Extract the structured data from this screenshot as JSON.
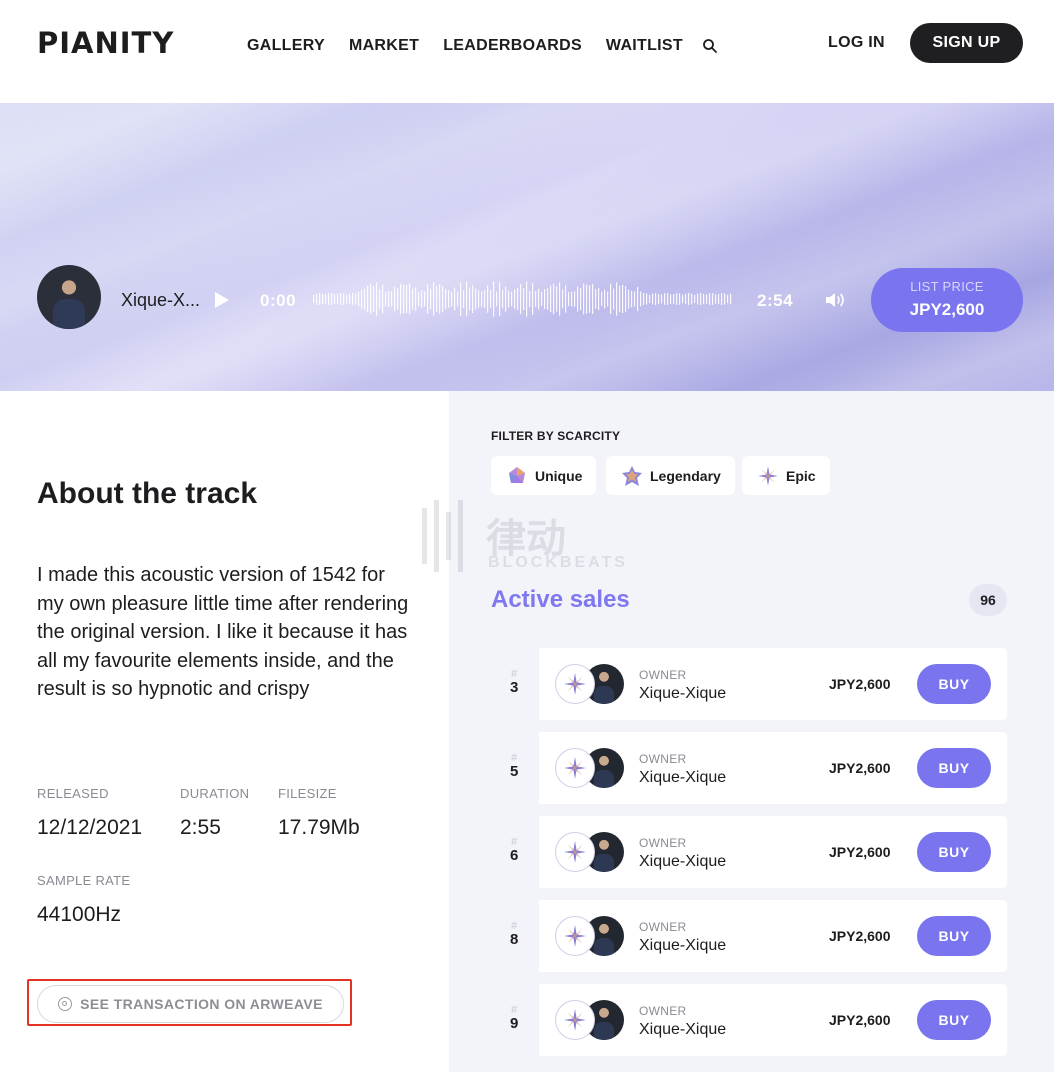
{
  "header": {
    "logo": "PIANITY",
    "nav": [
      "GALLERY",
      "MARKET",
      "LEADERBOARDS",
      "WAITLIST"
    ],
    "login_label": "LOG IN",
    "signup_label": "SIGN UP",
    "search_icon": "search-icon"
  },
  "player": {
    "track_title": "Xique-X...",
    "current_time": "0:00",
    "duration": "2:54",
    "list_price_label": "LIST PRICE",
    "list_price_value": "JPY2,600",
    "progress": 0
  },
  "about": {
    "title": "About the track",
    "description": "I made this acoustic version of 1542 for my own pleasure little time after rendering the original version. I like it because it has all my favourite elements inside, and the result is so hypnotic and crispy",
    "released_label": "RELEASED",
    "released": "12/12/2021",
    "duration_label": "DURATION",
    "duration": "2:55",
    "filesize_label": "FILESIZE",
    "filesize": "17.79Mb",
    "sample_rate_label": "SAMPLE RATE",
    "sample_rate": "44100Hz",
    "arweave_label": "SEE TRANSACTION ON ARWEAVE"
  },
  "filter": {
    "label": "FILTER BY SCARCITY",
    "chips": [
      "Unique",
      "Legendary",
      "Epic"
    ]
  },
  "sales": {
    "title": "Active sales",
    "count": "96",
    "hash": "#",
    "owner_label": "OWNER",
    "buy_label": "BUY",
    "rows": [
      {
        "num": "3",
        "owner": "Xique-Xique",
        "price": "JPY2,600"
      },
      {
        "num": "5",
        "owner": "Xique-Xique",
        "price": "JPY2,600"
      },
      {
        "num": "6",
        "owner": "Xique-Xique",
        "price": "JPY2,600"
      },
      {
        "num": "8",
        "owner": "Xique-Xique",
        "price": "JPY2,600"
      },
      {
        "num": "9",
        "owner": "Xique-Xique",
        "price": "JPY2,600"
      }
    ]
  },
  "watermark": {
    "text": "律动",
    "sub": "BLOCKBEATS"
  },
  "colors": {
    "accent": "#7a74ef",
    "dark": "#1f1f22",
    "highlight": "#e33324"
  }
}
